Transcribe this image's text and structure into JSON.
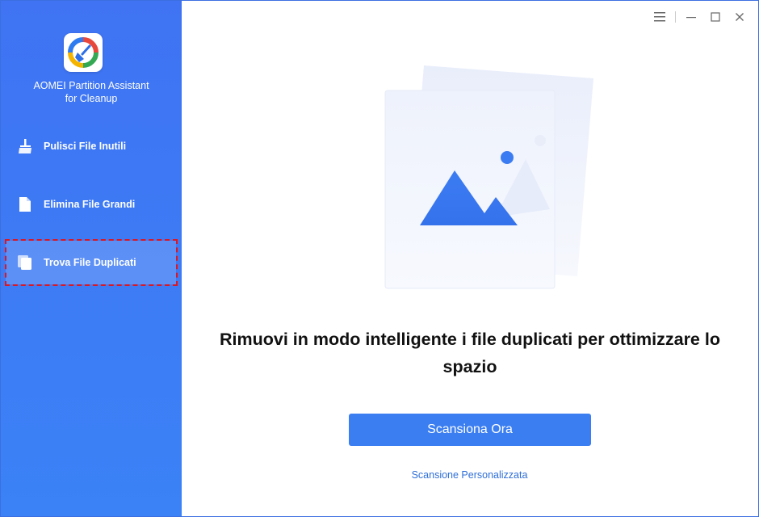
{
  "app": {
    "name_line1": "AOMEI Partition Assistant",
    "name_line2": "for Cleanup",
    "logo_icon": "broom-cleanup-logo"
  },
  "window_controls": {
    "menu_icon": "hamburger-menu-icon",
    "minimize_icon": "minimize-icon",
    "maximize_icon": "maximize-icon",
    "close_icon": "close-icon"
  },
  "sidebar": {
    "items": [
      {
        "label": "Pulisci File Inutili",
        "icon": "broom-icon",
        "active": false
      },
      {
        "label": "Elimina File Grandi",
        "icon": "file-icon",
        "active": false
      },
      {
        "label": "Trova File Duplicati",
        "icon": "duplicate-files-icon",
        "active": true
      }
    ]
  },
  "main": {
    "illustration_icon": "duplicate-images-illustration",
    "headline_line1": "Rimuovi in modo intelligente i file duplicati per ottimizzare lo",
    "headline_line2": "spazio",
    "scan_button": "Scansiona Ora",
    "custom_scan_link": "Scansione Personalizzata"
  },
  "colors": {
    "sidebar_blue": "#3f73f3",
    "accent_blue": "#3a7ef2",
    "highlight_red": "#e0161e"
  }
}
